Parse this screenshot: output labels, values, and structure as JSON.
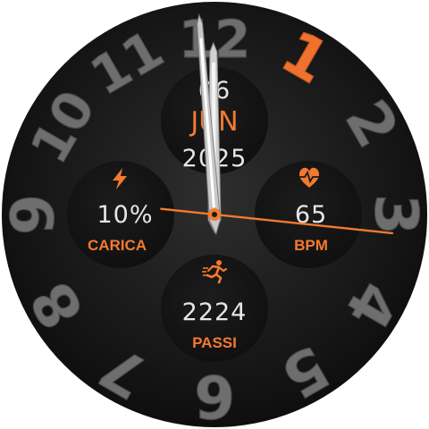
{
  "watch": {
    "dial_numerals": [
      "1",
      "2",
      "3",
      "4",
      "5",
      "6",
      "7",
      "8",
      "9",
      "10",
      "11",
      "12"
    ],
    "accent_numeral": "1",
    "date": {
      "day_number": "06",
      "month": "JUN",
      "year": "2025"
    },
    "battery": {
      "value": "10%",
      "label": "CARICA",
      "icon": "lightning-bolt-icon"
    },
    "heart_rate": {
      "value": "65",
      "label": "BPM",
      "icon": "heart-pulse-icon"
    },
    "steps": {
      "value": "2224",
      "label": "PASSI",
      "icon": "running-figure-icon"
    },
    "time": {
      "hours": 11,
      "minutes": 59,
      "seconds": 16
    },
    "colors": {
      "accent": "#f47a30",
      "text": "#e6e6e6",
      "numeral": "#6e6e6e",
      "face": "#1a1a1a"
    }
  }
}
